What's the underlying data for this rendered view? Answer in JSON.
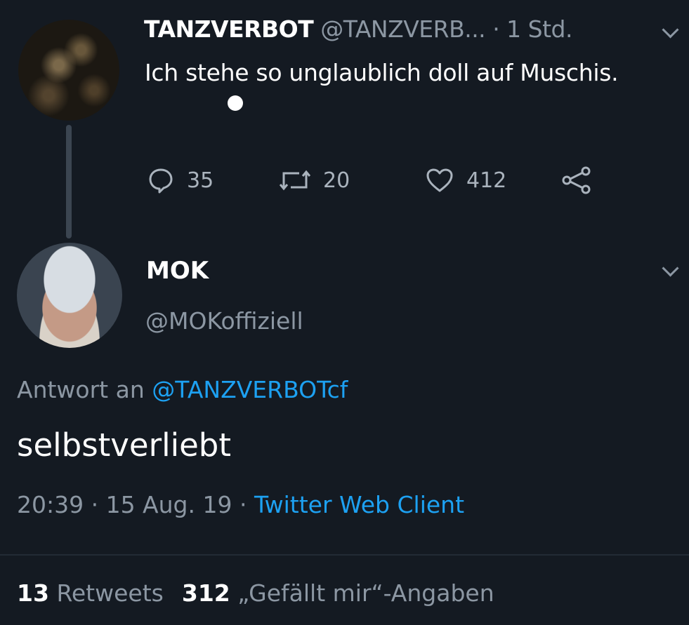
{
  "parent_tweet": {
    "author_name": "TANZVERBOT",
    "author_handle": "@TANZVERB...",
    "time": "· 1 Std.",
    "text": "Ich stehe so unglaublich doll auf Muschis.",
    "reply_count": "35",
    "retweet_count": "20",
    "like_count": "412"
  },
  "reply_tweet": {
    "author_name": "MOK",
    "author_handle": "@MOKoffiziell",
    "reply_to_label": "Antwort an",
    "reply_to_mention": "@TANZVERBOTcf",
    "text": "selbstverliebt",
    "timestamp": "20:39 · 15 Aug. 19 ·",
    "client": "Twitter Web Client",
    "retweets_count": "13",
    "retweets_label": "Retweets",
    "likes_count": "312",
    "likes_label": "„Gefällt mir“-Angaben"
  },
  "icons": {
    "reply": "speech-bubble-icon",
    "retweet": "retweet-icon",
    "like": "heart-icon",
    "share": "share-icon",
    "menu": "chevron-down-icon"
  },
  "colors": {
    "background": "#141a22",
    "accent": "#1da1f2",
    "secondary_text": "#8c97a3"
  }
}
